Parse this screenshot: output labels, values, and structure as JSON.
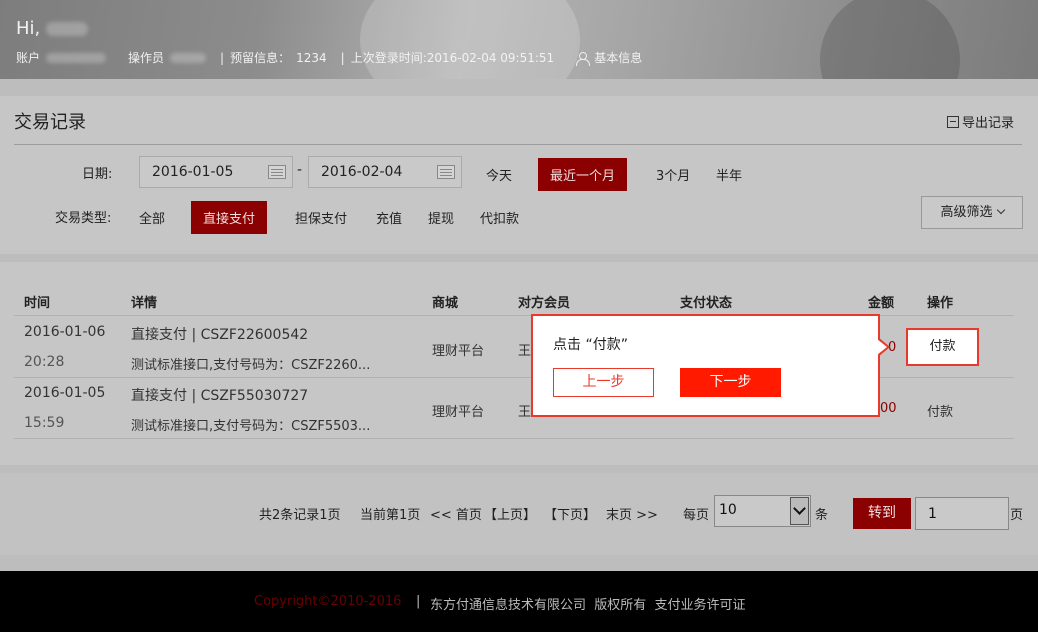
{
  "header": {
    "greeting": "Hi,",
    "account_label": "账户",
    "operator_label": "操作员",
    "reserved_label": "预留信息：",
    "reserved_value": "1234",
    "last_login_label": "上次登录时间:",
    "last_login_value": "2016-02-04 09:51:51",
    "basic_info": "基本信息",
    "separator": "|"
  },
  "filter": {
    "title": "交易记录",
    "export": "导出记录",
    "date_label": "日期:",
    "date_from": "2016-01-05",
    "date_to": "2016-02-04",
    "date_sep": "-",
    "ranges": [
      "今天",
      "最近一个月",
      "3个月",
      "半年"
    ],
    "active_range": "最近一个月",
    "type_label": "交易类型:",
    "types": [
      "全部",
      "直接支付",
      "担保支付",
      "充值",
      "提现",
      "代扣款"
    ],
    "active_type": "直接支付",
    "advanced": "高级筛选"
  },
  "table": {
    "columns": [
      "时间",
      "详情",
      "商城",
      "对方会员",
      "支付状态",
      "金额",
      "操作"
    ],
    "rows": [
      {
        "date": "2016-01-06",
        "time": "20:28",
        "detail": "直接支付 | CSZF22600542",
        "desc": "测试标准接口,支付号码为：CSZF2260...",
        "mall": "理财平台",
        "member": "王",
        "amount": "0",
        "action": "付款"
      },
      {
        "date": "2016-01-05",
        "time": "15:59",
        "detail": "直接支付 | CSZF55030727",
        "desc": "测试标准接口,支付号码为：CSZF5503...",
        "mall": "理财平台",
        "member": "王",
        "amount": "00",
        "action": "付款"
      }
    ]
  },
  "tooltip": {
    "text": "点击 “付款”",
    "prev": "上一步",
    "next": "下一步"
  },
  "pagination": {
    "summary": "共2条记录1页",
    "current": "当前第1页",
    "first": "<< 首页",
    "prev": "【上页】",
    "next": "【下页】",
    "last": "末页 >>",
    "per_page_label": "每页",
    "per_page_value": "10",
    "per_page_unit": "条",
    "go": "转到",
    "page_value": "1",
    "page_unit": "页"
  },
  "footer": {
    "copyright": "Copyright©2010-2016",
    "separator": "|",
    "company": "东方付通信息技术有限公司  版权所有  支付业务许可证"
  }
}
